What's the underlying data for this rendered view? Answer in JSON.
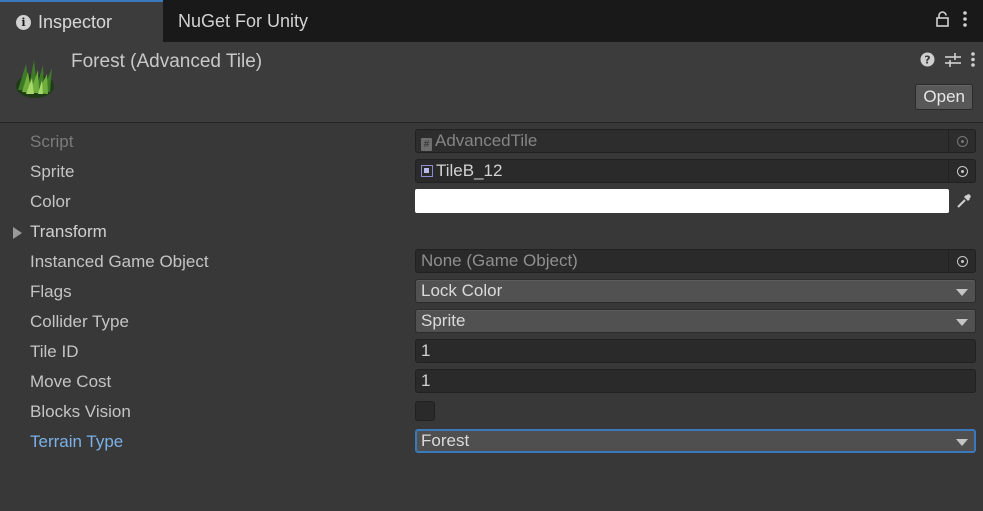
{
  "tabs": [
    {
      "label": "Inspector",
      "icon": "info-icon",
      "active": true
    },
    {
      "label": "NuGet For Unity",
      "active": false
    }
  ],
  "header": {
    "title": "Forest (Advanced Tile)",
    "open_label": "Open",
    "icons": [
      "help-icon",
      "preset-icon",
      "kebab-menu-icon"
    ]
  },
  "properties": {
    "script": {
      "label": "Script",
      "value": "AdvancedTile",
      "icon": "script-icon"
    },
    "sprite": {
      "label": "Sprite",
      "value": "TileB_12",
      "icon": "sprite-icon"
    },
    "color": {
      "label": "Color",
      "value": "#FFFFFF"
    },
    "transform": {
      "label": "Transform"
    },
    "instanced_game_object": {
      "label": "Instanced Game Object",
      "value": "None (Game Object)"
    },
    "flags": {
      "label": "Flags",
      "value": "Lock Color"
    },
    "collider_type": {
      "label": "Collider Type",
      "value": "Sprite"
    },
    "tile_id": {
      "label": "Tile ID",
      "value": "1"
    },
    "move_cost": {
      "label": "Move Cost",
      "value": "1"
    },
    "blocks_vision": {
      "label": "Blocks Vision",
      "checked": false
    },
    "terrain_type": {
      "label": "Terrain Type",
      "value": "Forest"
    }
  },
  "colors": {
    "accent": "#3A79BB",
    "highlight_label": "#7BB1E6",
    "panel_bg": "#383838",
    "tabbar_bg": "#191919"
  }
}
